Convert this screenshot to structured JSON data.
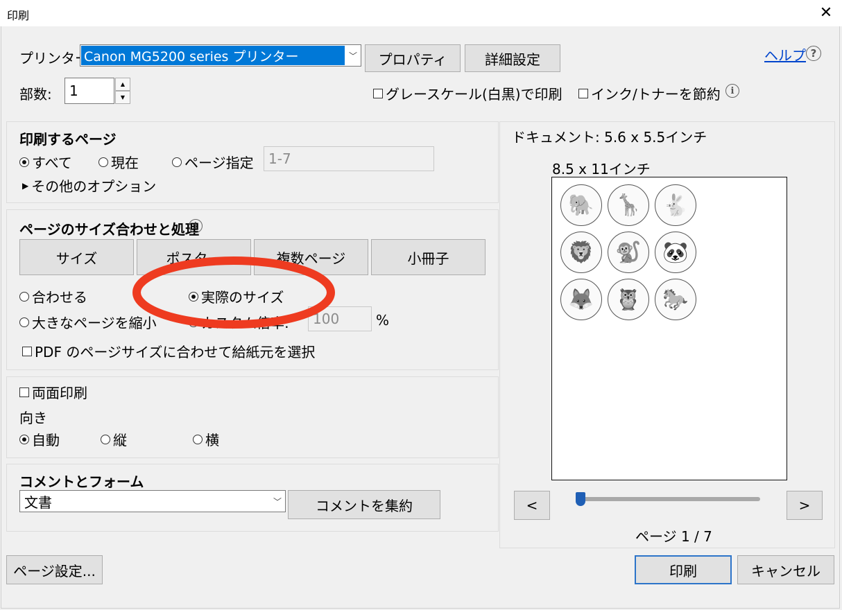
{
  "window": {
    "title": "印刷"
  },
  "printer": {
    "label": "プリンター:",
    "value": "Canon MG5200 series プリンター",
    "properties_label": "プロパティ",
    "advanced_label": "詳細設定",
    "help_label": "ヘルプ"
  },
  "copies": {
    "label": "部数:",
    "value": "1"
  },
  "options": {
    "grayscale": "グレースケール(白黒)で印刷",
    "save_ink": "インク/トナーを節約"
  },
  "pages": {
    "heading": "印刷するページ",
    "all": "すべて",
    "current": "現在",
    "range": "ページ指定",
    "range_value": "1-7",
    "more": "その他のオプション"
  },
  "sizing": {
    "heading": "ページのサイズ合わせと処理",
    "tabs": [
      "サイズ",
      "ポスター",
      "複数ページ",
      "小冊子"
    ],
    "fit": "合わせる",
    "actual": "実際のサイズ",
    "shrink": "大きなページを縮小",
    "custom": "カスタム倍率:",
    "custom_value": "100",
    "percent": "%",
    "paper_source": "PDF のページサイズに合わせて給紙元を選択"
  },
  "duplex": {
    "label": "両面印刷"
  },
  "orientation": {
    "heading": "向き",
    "auto": "自動",
    "portrait": "縦",
    "landscape": "横"
  },
  "comments": {
    "heading": "コメントとフォーム",
    "value": "文書",
    "summarize_label": "コメントを集約"
  },
  "preview": {
    "document_size": "ドキュメント: 5.6 x 5.5インチ",
    "paper_size": "8.5 x 11インチ",
    "prev": "<",
    "next": ">",
    "page_indicator": "ページ 1 / 7",
    "slider_fraction": 0,
    "animals": [
      "elephant",
      "giraffe",
      "rabbit",
      "lion",
      "monkey",
      "panda",
      "fox",
      "owl",
      "horse"
    ]
  },
  "footer": {
    "page_setup": "ページ設定...",
    "print": "印刷",
    "cancel": "キャンセル"
  },
  "colors": {
    "accent": "#2c74c9",
    "highlight": "#0078d7",
    "annotation": "#ee3b20"
  }
}
